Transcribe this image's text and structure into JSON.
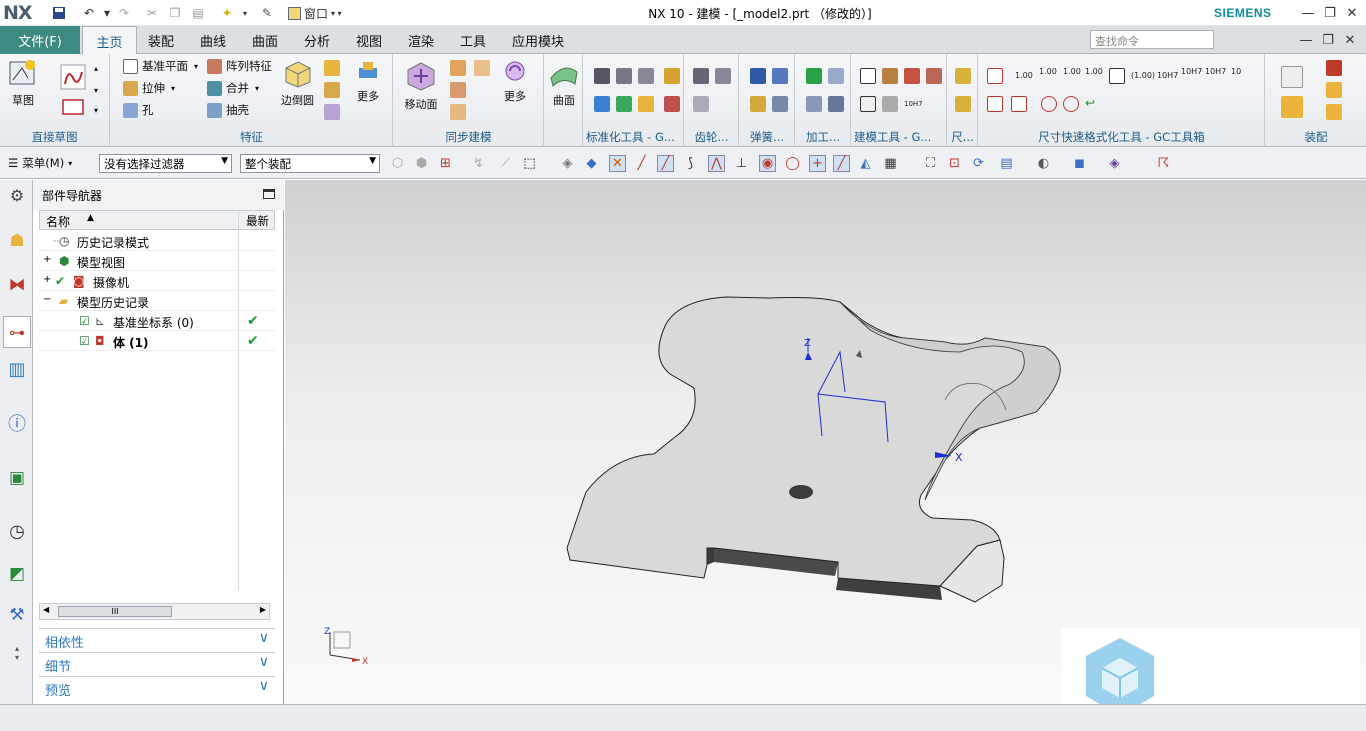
{
  "app": {
    "logo": "NX",
    "window_title": "NX 10 - 建模 - [_model2.prt （修改的）]",
    "brand": "SIEMENS",
    "window_menu_label": "窗口"
  },
  "ribbon_tabs": [
    "文件(F)",
    "主页",
    "装配",
    "曲线",
    "曲面",
    "分析",
    "视图",
    "渲染",
    "工具",
    "应用模块"
  ],
  "active_tab": "主页",
  "search": {
    "placeholder": "查找命令"
  },
  "ribbon": {
    "direct_sketch": {
      "label": "直接草图",
      "sketch": "草图"
    },
    "feature": {
      "label": "特征",
      "datum_plane": "基准平面",
      "pattern": "阵列特征",
      "extrude": "拉伸",
      "unite": "合并",
      "hole": "孔",
      "shell": "抽壳",
      "edge_blend": "边倒圆",
      "more": "更多"
    },
    "sync": {
      "label": "同步建模",
      "move_face": "移动面",
      "more": "更多"
    },
    "surface": {
      "label": "曲面"
    },
    "groups": [
      "标准化工具 - G...",
      "齿轮...",
      "弹簧...",
      "加工...",
      "建模工具 - G...",
      "尺...",
      "尺寸快速格式化工具 - GC工具箱",
      "装配"
    ],
    "dim_labels": [
      "1.00",
      "1.00",
      "1.00",
      "1.00",
      "(1.00)",
      "10H7",
      "10H7",
      "10H7",
      "10",
      "10H7"
    ]
  },
  "command_bar": {
    "menu": "菜单(M)",
    "filter": "没有选择过滤器",
    "scope": "整个装配"
  },
  "navigator": {
    "title": "部件导航器",
    "col_name": "名称",
    "col_latest": "最新",
    "rows": [
      {
        "label": "历史记录模式",
        "check": ""
      },
      {
        "label": "模型视图",
        "check": ""
      },
      {
        "label": "摄像机",
        "check": ""
      },
      {
        "label": "模型历史记录",
        "check": ""
      },
      {
        "label": "基准坐标系 (0)",
        "check": "✔"
      },
      {
        "label": "体 (1)",
        "check": "✔"
      }
    ],
    "scroll_thumb": "III",
    "panels": [
      "相依性",
      "细节",
      "预览"
    ]
  },
  "viewport": {
    "axis_x": "X",
    "axis_z": "Z",
    "triad_x": "X",
    "triad_z": "Z"
  },
  "colors": {
    "file_tab": "#3d8a83",
    "group_label": "#1d5c8a",
    "panel_text": "#2b79c2",
    "datum": "#1a2fd6"
  }
}
